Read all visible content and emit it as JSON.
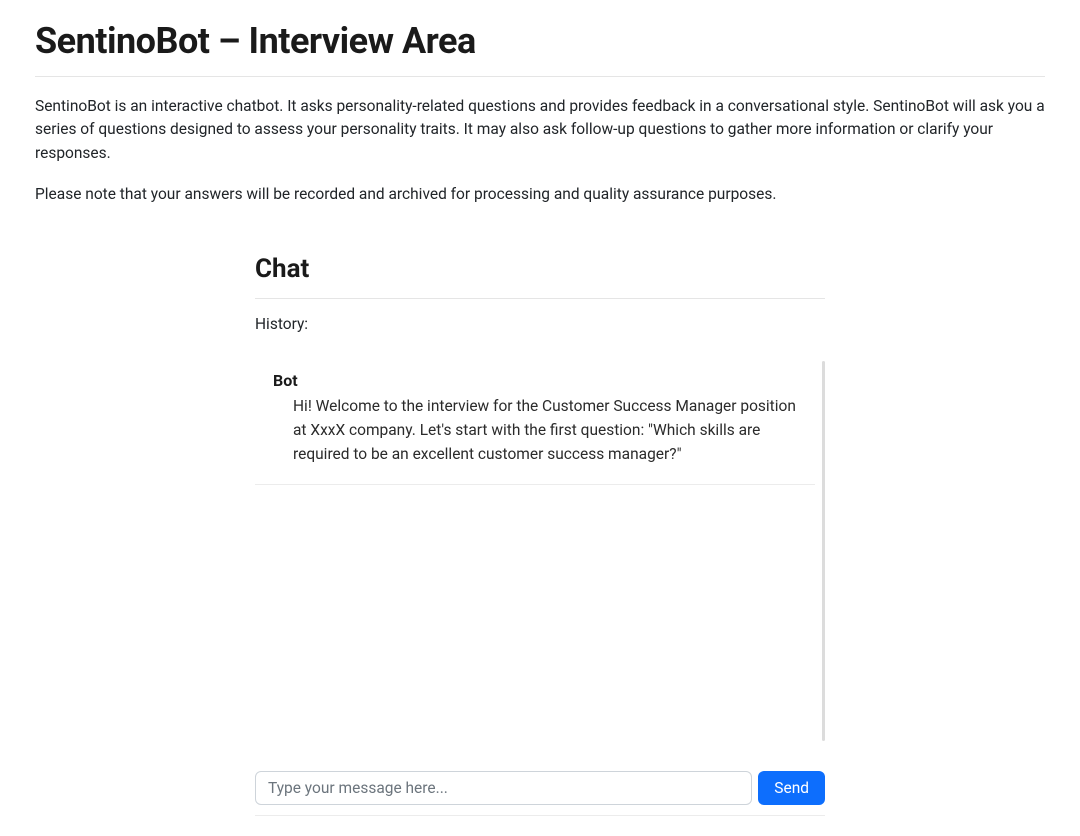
{
  "header": {
    "page_title": "SentinoBot – Interview Area",
    "intro_paragraph_1": "SentinoBot is an interactive chatbot. It asks personality-related questions and provides feedback in a conversational style. SentinoBot will ask you a series of questions designed to assess your personality traits. It may also ask follow-up questions to gather more information or clarify your responses.",
    "intro_paragraph_2": "Please note that your answers will be recorded and archived for processing and quality assurance purposes."
  },
  "chat": {
    "title": "Chat",
    "history_label": "History:",
    "messages": [
      {
        "sender": "Bot",
        "body": "Hi! Welcome to the interview for the Customer Success Manager position at XxxX company. Let's start with the first question: \"Which skills are required to be an excellent customer success manager?\""
      }
    ],
    "input_placeholder": "Type your message here...",
    "send_label": "Send"
  }
}
